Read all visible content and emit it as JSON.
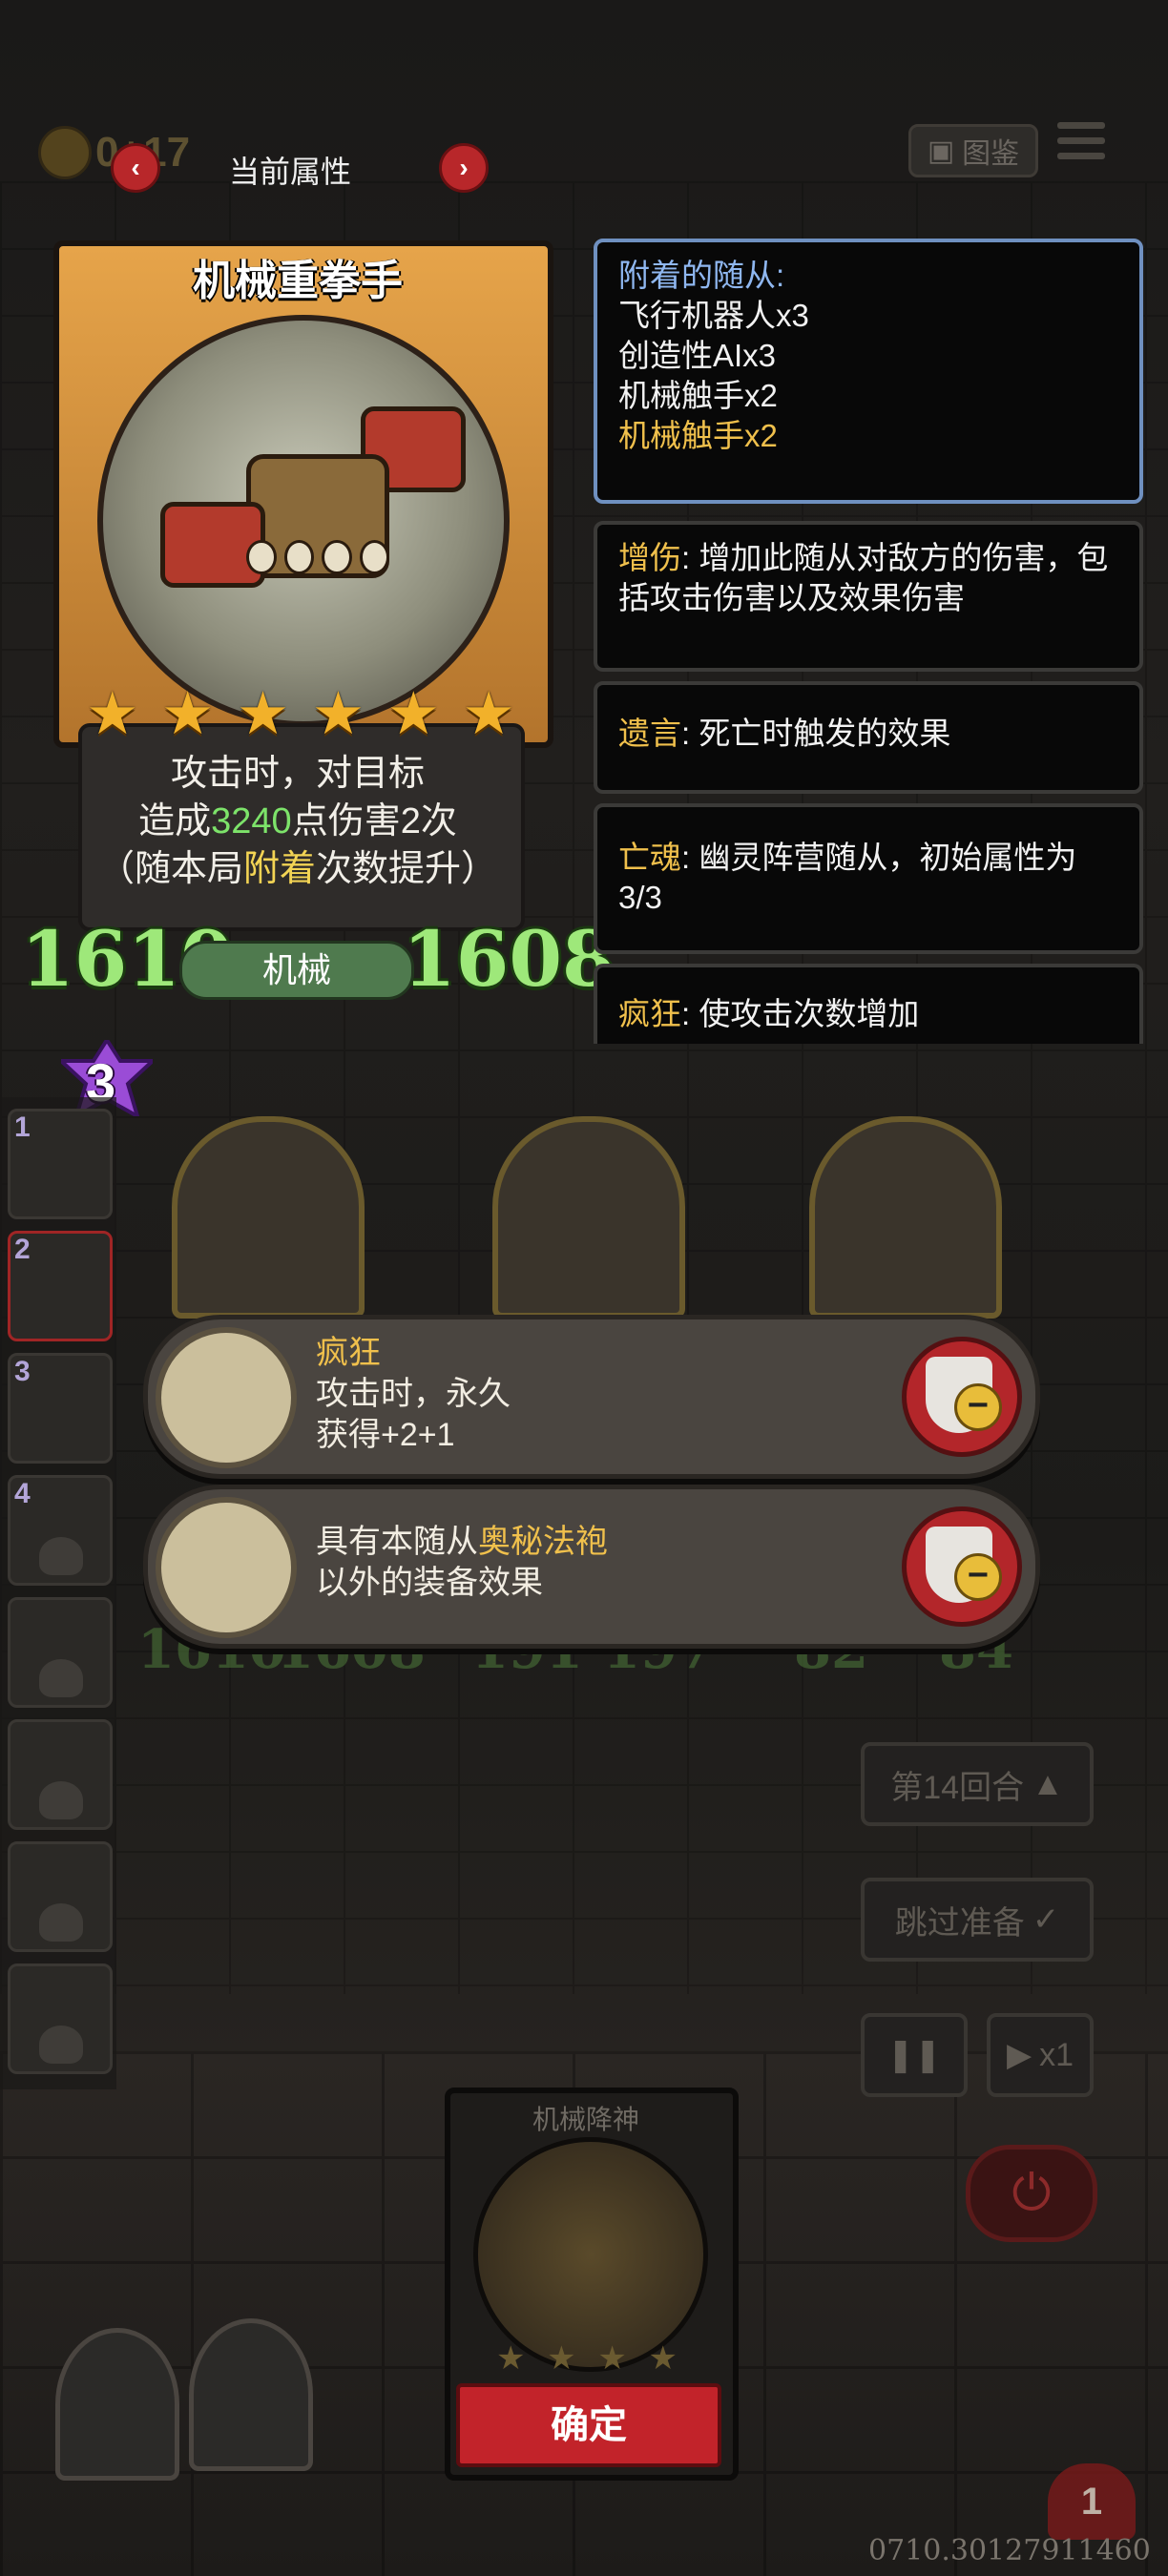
{
  "top_bar": {
    "gold": "0+17",
    "current_attr_label": "当前属性",
    "prev_arrow": "‹",
    "next_arrow": "›",
    "codex_label": "图鉴"
  },
  "card": {
    "name": "机械重拳手",
    "stars": 6,
    "desc_line1": "攻击时，对目标",
    "desc_line2_pre": "造成",
    "damage": "3240",
    "desc_line2_mid": "点伤害",
    "hits": "2",
    "desc_line2_post": "次",
    "desc_line3_pre": "（随本局",
    "desc_line3_key": "附着",
    "desc_line3_post": "次数提升）",
    "attack": "1610",
    "health": "1608",
    "type": "机械",
    "tier": "3"
  },
  "panels": {
    "attached": {
      "title": "附着的随从:",
      "items": [
        "飞行机器人x3",
        "创造性AIx3",
        "机械触手x2",
        "机械触手x2"
      ]
    },
    "keywords": [
      {
        "key": "增伤",
        "text": ": 增加此随从对敌方的伤害，包括攻击伤害以及效果伤害"
      },
      {
        "key": "遗言",
        "text": ": 死亡时触发的效果"
      },
      {
        "key": "亡魂",
        "text": ": 幽灵阵营随从，初始属性为3/3"
      },
      {
        "key": "疯狂",
        "text": ": 使攻击次数增加"
      }
    ]
  },
  "sidebar": {
    "slots": [
      "1",
      "2",
      "3",
      "4",
      "",
      "",
      "",
      ""
    ]
  },
  "board": {
    "minions": [
      {
        "atk": "1610",
        "hp": "1608"
      },
      {
        "atk": "191",
        "hp": "197"
      },
      {
        "atk": "82",
        "hp": "84"
      }
    ]
  },
  "popups": [
    {
      "title": "疯狂",
      "line1": "攻击时，永久",
      "line2": "获得+2+1"
    },
    {
      "line1_pre": "具有本随从",
      "line1_key": "奥秘法袍",
      "line2": "以外的装备效果"
    }
  ],
  "controls": {
    "round_label": "第14回合",
    "skip_label": "跳过准备",
    "speed_label": "x1"
  },
  "bottom_card": {
    "name": "机械降神",
    "confirm_label": "确定"
  },
  "lives": "1",
  "version": "0710.30127911460"
}
